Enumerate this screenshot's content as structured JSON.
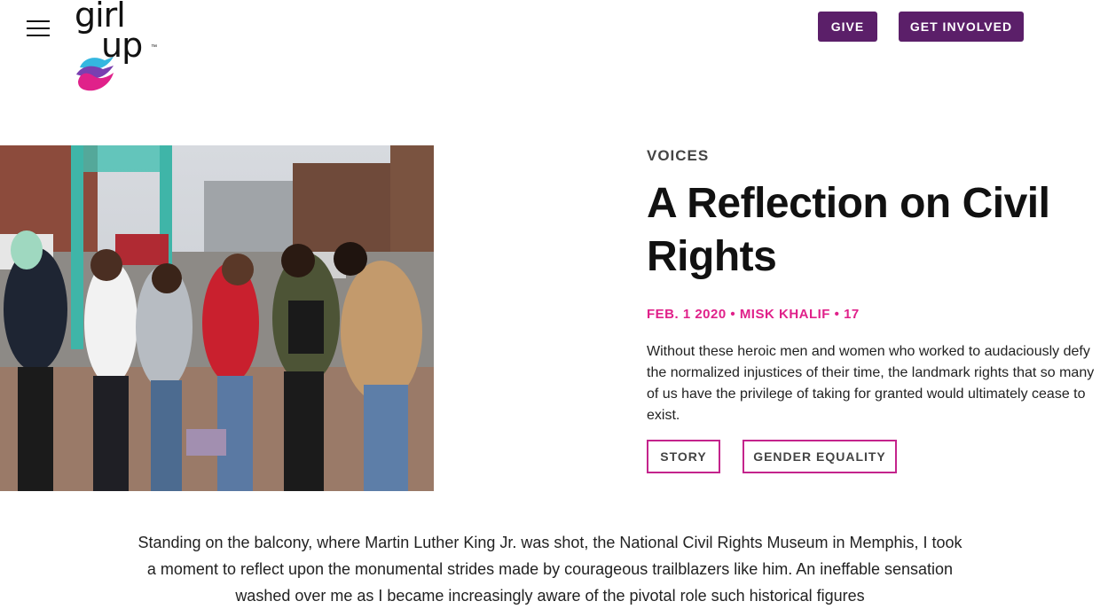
{
  "header": {
    "logo_text_line1": "girl",
    "logo_text_line2": "up",
    "logo_tm": "™",
    "give_label": "GIVE",
    "get_involved_label": "GET INVOLVED"
  },
  "article": {
    "category": "VOICES",
    "title": "A Reflection on Civil Rights",
    "meta": {
      "date": "FEB. 1 2020",
      "separator": " • ",
      "author": "MISK KHALIF",
      "count": "17"
    },
    "excerpt": "Without these heroic men and women who worked to audaciously defy the normalized injustices of their time, the landmark rights that so many of us have the privilege of taking for granted would ultimately cease to exist.",
    "tags": [
      "STORY",
      "GENDER EQUALITY"
    ],
    "body": "Standing on the balcony, where Martin Luther King Jr. was shot, the National Civil Rights Museum in Memphis, I took a moment to reflect upon the monumental strides made by courageous trailblazers like him. An ineffable sensation washed over me as I became increasingly aware of the pivotal role such historical figures"
  },
  "colors": {
    "brand_purple": "#5b1f69",
    "accent_pink": "#e0218a",
    "tag_border": "#c4248c"
  },
  "icons": {
    "menu": "hamburger-menu-icon",
    "logo_hand": "girl-up-hand-logo"
  }
}
